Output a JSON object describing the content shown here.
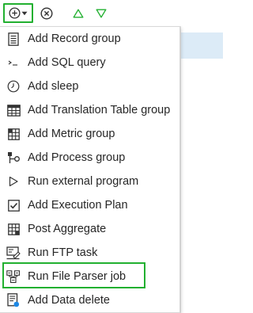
{
  "colors": {
    "highlight_border": "#22b030",
    "toolbar_arrow": "#22b030",
    "selected_row": "#dcebf7",
    "icon_dark": "#333333",
    "icon_accent_blue": "#1e88e5"
  },
  "toolbar": {
    "add_icon": "plus-circle-icon",
    "dropdown_icon": "caret-down-icon",
    "clear_icon": "x-circle-icon",
    "up_icon": "triangle-up-outline-icon",
    "down_icon": "triangle-down-outline-icon"
  },
  "menu": {
    "items": [
      {
        "label": "Add Record group",
        "icon": "document-list-icon"
      },
      {
        "label": "Add SQL query",
        "icon": "terminal-prompt-icon"
      },
      {
        "label": "Add sleep",
        "icon": "clock-icon"
      },
      {
        "label": "Add Translation Table group",
        "icon": "table-grid-icon"
      },
      {
        "label": "Add Metric group",
        "icon": "metric-grid-icon"
      },
      {
        "label": "Add Process group",
        "icon": "process-flow-icon"
      },
      {
        "label": "Run external program",
        "icon": "play-outline-icon"
      },
      {
        "label": "Add Execution Plan",
        "icon": "checkbox-icon"
      },
      {
        "label": "Post Aggregate",
        "icon": "aggregate-grid-icon"
      },
      {
        "label": "Run FTP task",
        "icon": "ftp-task-icon"
      },
      {
        "label": "Run File Parser job",
        "icon": "file-parser-icon",
        "highlighted": true
      },
      {
        "label": "Add Data delete",
        "icon": "data-delete-icon"
      }
    ]
  }
}
